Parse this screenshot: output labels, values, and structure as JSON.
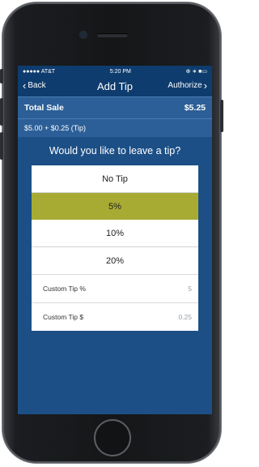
{
  "status": {
    "carrier": "●●●●● AT&T",
    "time": "5:20 PM",
    "right": "⊕ ∗ ■▭"
  },
  "nav": {
    "back_label": "Back",
    "title": "Add Tip",
    "authorize_label": "Authorize"
  },
  "sale": {
    "label": "Total Sale",
    "amount": "$5.25",
    "breakdown": "$5.00 + $0.25 (Tip)"
  },
  "question": "Would you like to leave a tip?",
  "options": [
    "No Tip",
    "5%",
    "10%",
    "20%"
  ],
  "selected_option": "5%",
  "custom": [
    {
      "label": "Custom Tip %",
      "value": "5"
    },
    {
      "label": "Custom Tip $",
      "value": "0.25"
    }
  ],
  "colors": {
    "nav": "#0e3c6e",
    "background": "#1c4f86",
    "selected": "#a7ab33"
  }
}
